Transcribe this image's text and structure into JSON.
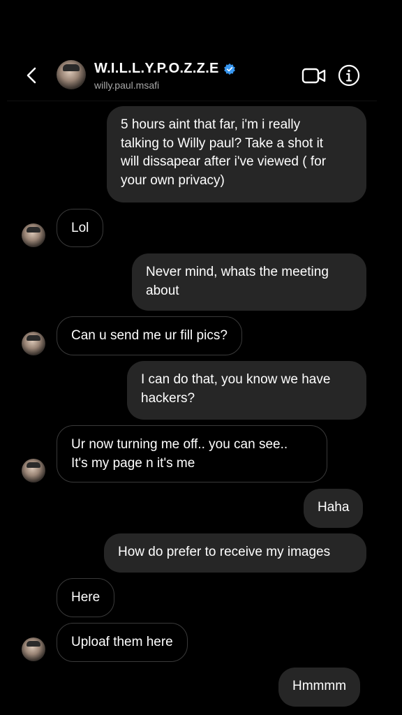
{
  "header": {
    "title": "W.I.L.L.Y.P.O.Z.Z.E",
    "subtitle": "willy.paul.msafi",
    "icons": [
      "back-arrow-icon",
      "verified-badge-icon",
      "video-call-icon",
      "info-icon"
    ],
    "colors": {
      "verified": "#3897f0",
      "background": "#000000"
    }
  },
  "messages": [
    {
      "sender": "me",
      "text": "5 hours aint that far, i'm i really\ntalking to Willy paul? Take a shot it\nwill dissapear after i've viewed ( for\nyour own privacy)"
    },
    {
      "sender": "them",
      "text": "Lol"
    },
    {
      "sender": "me",
      "text": "Never mind, whats the meeting\nabout"
    },
    {
      "sender": "them",
      "text": "Can u send me ur fill pics?"
    },
    {
      "sender": "me",
      "text": "I can do that, you know we have\nhackers?"
    },
    {
      "sender": "them",
      "text": "Ur now turning me off.. you can see..\nIt's my page n it's me"
    },
    {
      "sender": "me",
      "text": "Haha"
    },
    {
      "sender": "me",
      "text": "How do prefer to receive my images"
    },
    {
      "sender": "them",
      "text": "Here"
    },
    {
      "sender": "them",
      "text": "Uploaf them here"
    },
    {
      "sender": "me",
      "text": "Hmmmm"
    }
  ],
  "colors": {
    "outgoing_bubble": "#262626",
    "incoming_border": "#3a3a3a",
    "subtitle": "#a8a8a8"
  }
}
